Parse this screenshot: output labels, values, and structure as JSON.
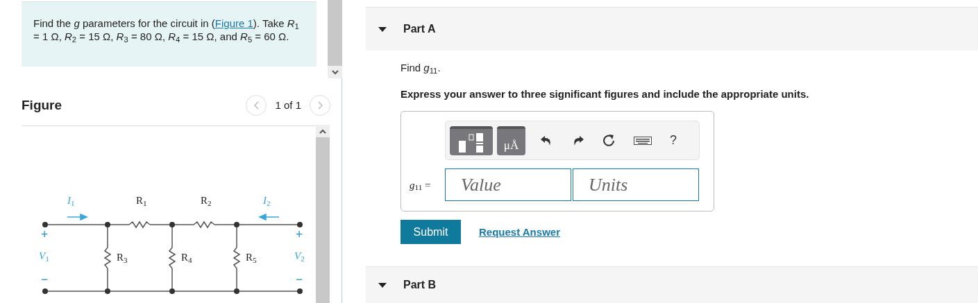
{
  "problem": {
    "before": "Find the *g* parameters for the circuit in (",
    "link": "Figure 1",
    "after": "). Take *R*$_{1}$ = 1 Ω, *R*$_{2}$ = 15 Ω, *R*$_{3}$ = 80 Ω, *R*$_{4}$ = 15 Ω, and *R*$_{5}$ = 60 Ω."
  },
  "figure": {
    "heading": "Figure",
    "pager": "1 of 1",
    "labels": [
      {
        "kind": "current",
        "text": "*I*$_{1}$"
      },
      {
        "kind": "resistor",
        "text": "R$_{1}$"
      },
      {
        "kind": "resistor",
        "text": "R$_{2}$"
      },
      {
        "kind": "current",
        "text": "*I*$_{2}$"
      },
      {
        "kind": "sign",
        "text": "+"
      },
      {
        "kind": "voltage",
        "text": "*V*$_{1}$"
      },
      {
        "kind": "sign",
        "text": "−"
      },
      {
        "kind": "resistor",
        "text": "R$_{3}$"
      },
      {
        "kind": "resistor",
        "text": "R$_{4}$"
      },
      {
        "kind": "resistor",
        "text": "R$_{5}$"
      },
      {
        "kind": "sign",
        "text": "+"
      },
      {
        "kind": "voltage",
        "text": "*V*$_{2}$"
      },
      {
        "kind": "sign",
        "text": "−"
      }
    ]
  },
  "parts": [
    {
      "title": "Part A"
    },
    {
      "title": "Part B"
    }
  ],
  "question": {
    "prompt": "Find *g*$_{11}$.",
    "instruction": "Express your answer to three significant figures and include the appropriate units.",
    "toolbar": {
      "units_button": "μÅ",
      "help": "?"
    },
    "field_label": "*g*$_{11}$ =",
    "value_placeholder": "Value",
    "units_placeholder": "Units"
  },
  "actions": {
    "submit": "Submit",
    "request": "Request Answer"
  }
}
